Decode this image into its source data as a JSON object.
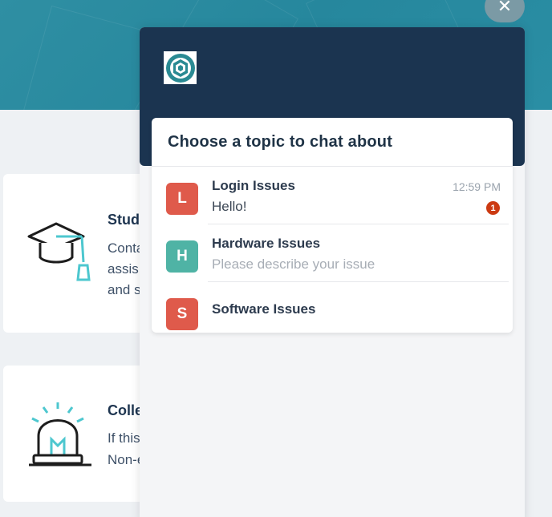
{
  "background": {
    "cards": [
      {
        "title": "Stud",
        "lines": [
          "Conta",
          "assis",
          "and s"
        ]
      },
      {
        "title": "Colle",
        "lines": [
          "If this",
          "Non-e"
        ]
      }
    ],
    "accent_color": "#4dc7cf"
  },
  "widget": {
    "close_label": "✕",
    "header_color": "#1b3450",
    "topics_title": "Choose a topic to chat about",
    "topics": [
      {
        "initial": "L",
        "name": "Login Issues",
        "message": "Hello!",
        "time": "12:59 PM",
        "unread": "1",
        "color": "#df5a4b",
        "message_color": "#3b4654"
      },
      {
        "initial": "H",
        "name": "Hardware Issues",
        "message": "Please describe your issue",
        "color": "#4fb3a5",
        "message_color": "#a7adb5"
      },
      {
        "initial": "S",
        "name": "Software Issues",
        "color": "#df5a4b"
      }
    ]
  }
}
